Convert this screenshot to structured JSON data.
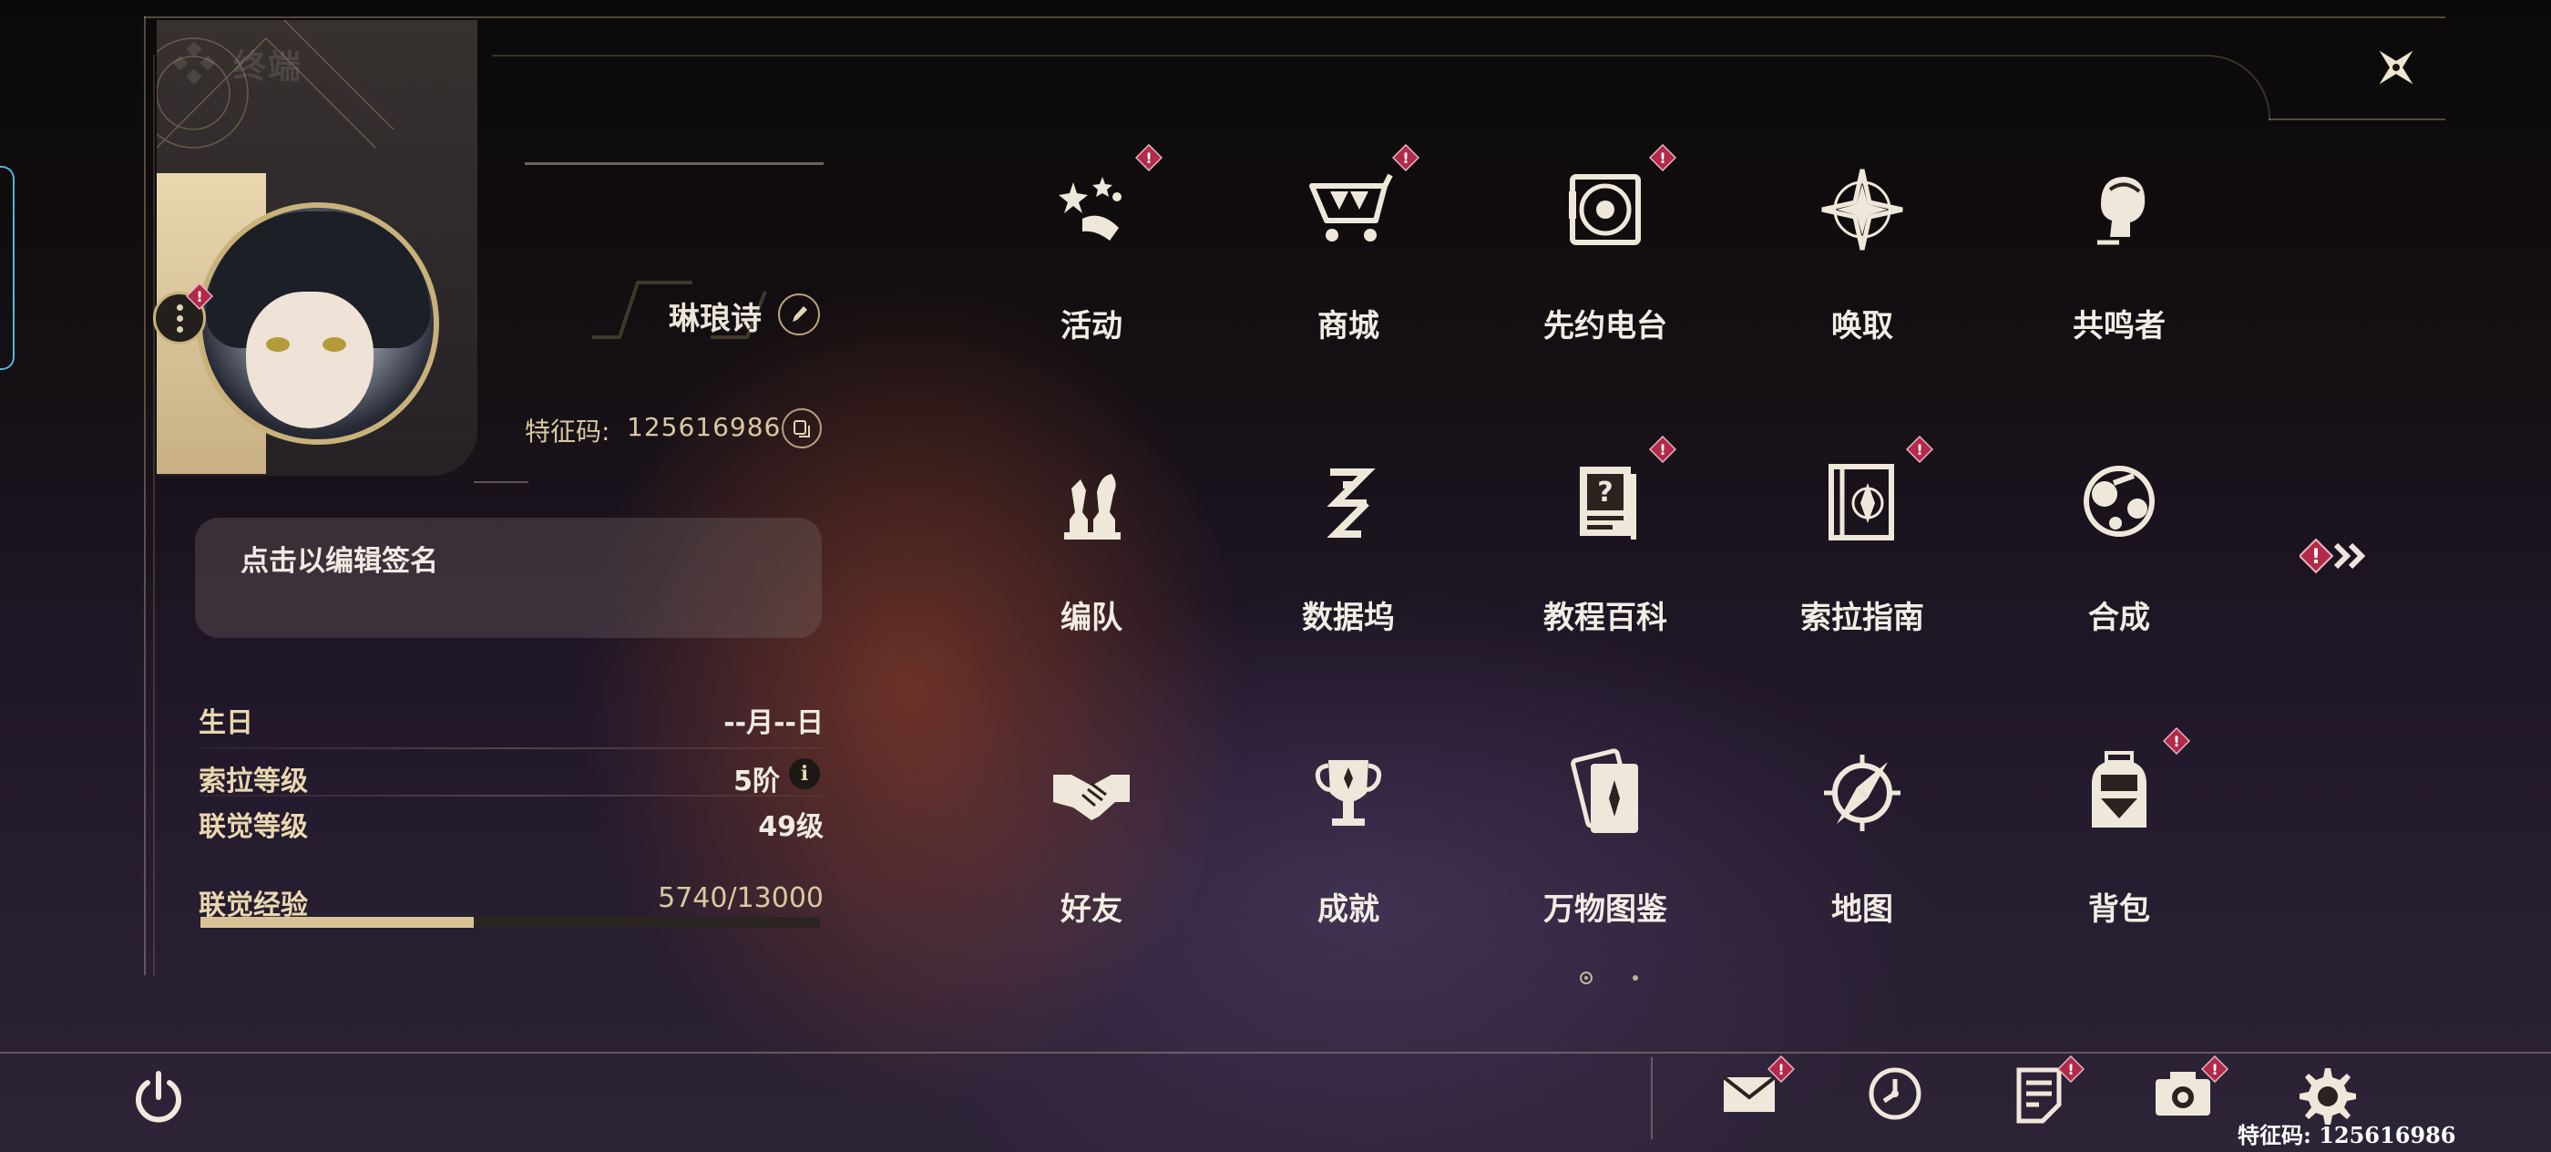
{
  "header": {
    "title": "终端",
    "title_icon": "diamond-cluster-icon",
    "close_icon": "close-star-icon"
  },
  "profile": {
    "name": "琳琅诗",
    "uid_label": "特征码:",
    "uid_value": "125616986",
    "signature_placeholder": "点击以编辑签名",
    "stats": [
      {
        "label": "生日",
        "value": "--月--日"
      },
      {
        "label": "索拉等级",
        "value": "5阶"
      },
      {
        "label": "联觉等级",
        "value": "49级"
      }
    ],
    "xp": {
      "label": "联觉经验",
      "value": "5740/13000",
      "current": 5740,
      "max": 13000
    }
  },
  "menu": {
    "items": [
      {
        "label": "活动",
        "icon": "activity-stars-icon",
        "badge": true
      },
      {
        "label": "商城",
        "icon": "shop-cart-icon",
        "badge": true
      },
      {
        "label": "先约电台",
        "icon": "radio-disc-icon",
        "badge": true
      },
      {
        "label": "唤取",
        "icon": "summon-compass-star-icon",
        "badge": false
      },
      {
        "label": "共鸣者",
        "icon": "resonator-head-icon",
        "badge": false
      },
      {
        "label": "编队",
        "icon": "chess-team-icon",
        "badge": false
      },
      {
        "label": "数据坞",
        "icon": "data-dock-icon",
        "badge": false
      },
      {
        "label": "教程百科",
        "icon": "tutorial-book-icon",
        "badge": true
      },
      {
        "label": "索拉指南",
        "icon": "guide-book-icon",
        "badge": true
      },
      {
        "label": "合成",
        "icon": "synthesis-icon",
        "badge": false
      },
      {
        "label": "好友",
        "icon": "handshake-icon",
        "badge": false
      },
      {
        "label": "成就",
        "icon": "trophy-icon",
        "badge": false
      },
      {
        "label": "万物图鉴",
        "icon": "card-collection-icon",
        "badge": false
      },
      {
        "label": "地图",
        "icon": "map-compass-icon",
        "badge": false
      },
      {
        "label": "背包",
        "icon": "backpack-icon",
        "badge": true
      }
    ],
    "pager": {
      "current": 1,
      "total": 2
    }
  },
  "bottom_bar": {
    "left": {
      "icon": "power-icon"
    },
    "buttons": [
      {
        "icon": "mail-icon",
        "badge": true
      },
      {
        "icon": "clock-icon",
        "badge": false
      },
      {
        "icon": "notes-icon",
        "badge": true
      },
      {
        "icon": "camera-icon",
        "badge": true
      },
      {
        "icon": "settings-gear-icon",
        "badge": false
      }
    ],
    "uid_footer": "特征码: 125616986"
  },
  "colors": {
    "gold": "#c9b17a",
    "badge_red": "#b3294a",
    "text": "#ece6da"
  }
}
